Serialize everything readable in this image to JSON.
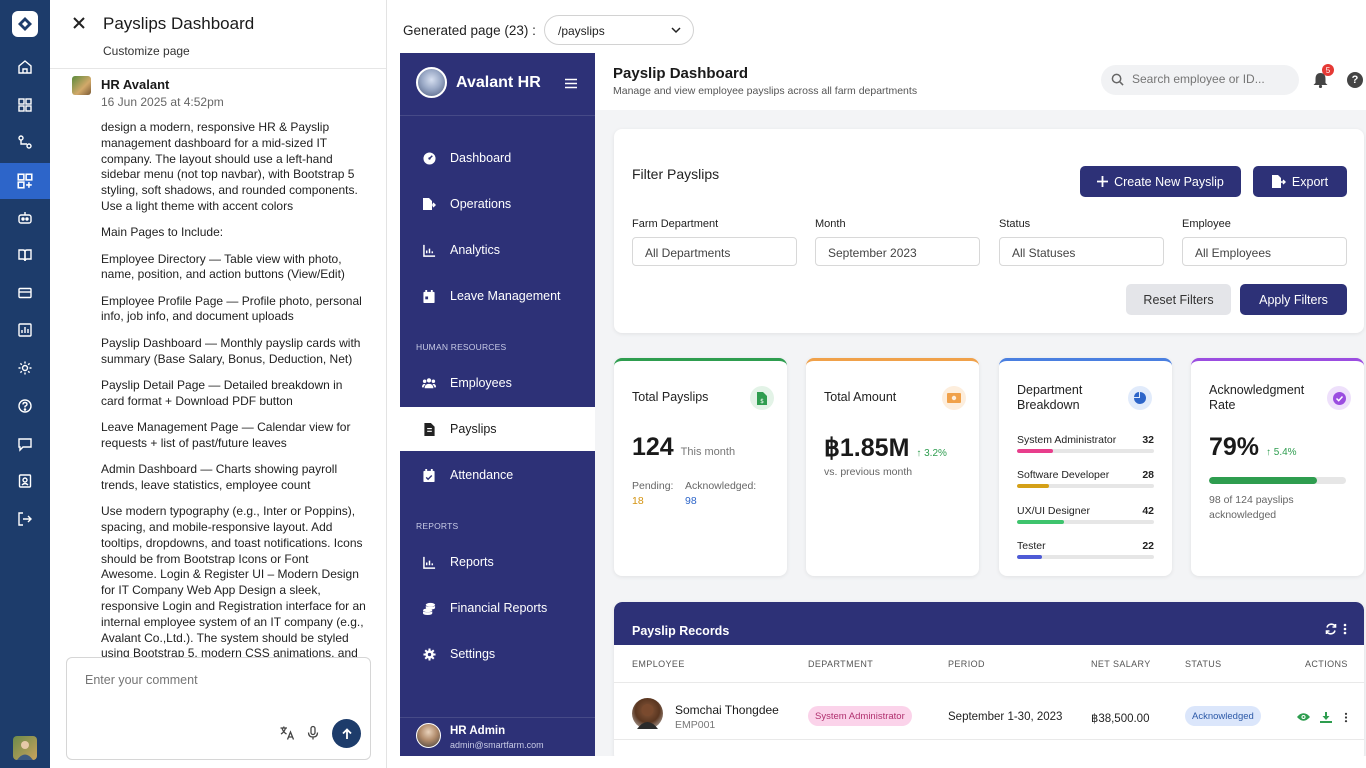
{
  "chat": {
    "title": "Payslips Dashboard",
    "subtitle": "Customize page",
    "author": "HR Avalant",
    "time": "16 Jun 2025 at 4:52pm",
    "paragraphs": [
      "design a modern, responsive HR & Payslip management dashboard for a mid-sized IT company. The layout should use a left-hand sidebar menu (not top navbar), with Bootstrap 5 styling, soft shadows, and rounded components. Use a light theme with accent colors",
      "Main Pages to Include:",
      "Employee Directory — Table view with photo, name, position, and action buttons (View/Edit)",
      "Employee Profile Page — Profile photo, personal info, job info, and document uploads",
      "Payslip Dashboard — Monthly payslip cards with summary (Base Salary, Bonus, Deduction, Net)",
      "Payslip Detail Page — Detailed breakdown in card format + Download PDF button",
      "Leave Management Page — Calendar view for requests + list of past/future leaves",
      "Admin Dashboard — Charts showing payroll trends, leave statistics, employee count",
      "Use modern typography (e.g., Inter or Poppins), spacing, and mobile-responsive layout. Add tooltips, dropdowns, and toast notifications. Icons should be from Bootstrap Icons or Font Awesome. Login & Register UI – Modern Design for IT Company Web App Design a sleek, responsive Login and Registration interface for an internal employee system of an IT company (e.g., Avalant Co.,Ltd.). The system should be styled using Bootstrap 5, modern CSS animations, and"
    ],
    "comment_placeholder": "Enter your comment"
  },
  "generator": {
    "label": "Generated page (23) :",
    "selected_page": "/payslips"
  },
  "sidebar": {
    "brand": "Avalant HR",
    "nav_main": [
      {
        "label": "Dashboard",
        "icon": "gauge-icon"
      },
      {
        "label": "Operations",
        "icon": "file-export-icon"
      },
      {
        "label": "Analytics",
        "icon": "chart-line-icon"
      },
      {
        "label": "Leave Management",
        "icon": "calendar-icon"
      }
    ],
    "section_hr": "HUMAN RESOURCES",
    "nav_hr": [
      {
        "label": "Employees",
        "icon": "users-icon"
      },
      {
        "label": "Payslips",
        "icon": "invoice-icon",
        "active": true
      },
      {
        "label": "Attendance",
        "icon": "calendar-check-icon"
      }
    ],
    "section_reports": "REPORTS",
    "nav_reports": [
      {
        "label": "Reports",
        "icon": "chart-line-icon"
      },
      {
        "label": "Financial Reports",
        "icon": "coins-icon"
      },
      {
        "label": "Settings",
        "icon": "gear-icon"
      }
    ],
    "user": {
      "name": "HR Admin",
      "email": "admin@smartfarm.com"
    }
  },
  "header": {
    "title": "Payslip Dashboard",
    "subtitle": "Manage and view employee payslips across all farm departments",
    "search_placeholder": "Search employee or ID...",
    "notification_count": "5",
    "help": "?"
  },
  "filters": {
    "title": "Filter Payslips",
    "create_label": "Create New Payslip",
    "export_label": "Export",
    "fields": [
      {
        "label": "Farm Department",
        "value": "All Departments"
      },
      {
        "label": "Month",
        "value": "September 2023"
      },
      {
        "label": "Status",
        "value": "All Statuses"
      },
      {
        "label": "Employee",
        "value": "All Employees"
      }
    ],
    "reset_label": "Reset Filters",
    "apply_label": "Apply Filters"
  },
  "stats": {
    "total_payslips": {
      "title": "Total Payslips",
      "value": "124",
      "suffix": "This month",
      "pending_label": "Pending:",
      "pending_value": "18",
      "ack_label": "Acknowledged:",
      "ack_value": "98"
    },
    "total_amount": {
      "title": "Total Amount",
      "value": "฿1.85M",
      "trend": "3.2%",
      "note": "vs. previous month"
    },
    "department": {
      "title": "Department Breakdown",
      "rows": [
        {
          "name": "System Administrator",
          "value": "32",
          "fraction": 0.26,
          "color": "#e83e8c"
        },
        {
          "name": "Software Developer",
          "value": "28",
          "fraction": 0.23,
          "color": "#d4a017"
        },
        {
          "name": "UX/UI Designer",
          "value": "42",
          "fraction": 0.34,
          "color": "#3ec46d"
        },
        {
          "name": "Tester",
          "value": "22",
          "fraction": 0.18,
          "color": "#4e5bd6"
        }
      ]
    },
    "ack_rate": {
      "title": "Acknowledgment Rate",
      "value": "79%",
      "trend": "5.4%",
      "fraction": 0.79,
      "note": "98 of 124 payslips acknowledged"
    }
  },
  "records": {
    "title": "Payslip Records",
    "columns": [
      "EMPLOYEE",
      "DEPARTMENT",
      "PERIOD",
      "NET SALARY",
      "STATUS",
      "ACTIONS"
    ],
    "rows": [
      {
        "name": "Somchai Thongdee",
        "id": "EMP001",
        "department": "System Administrator",
        "period": "September 1-30, 2023",
        "salary": "฿38,500.00",
        "status": "Acknowledged"
      }
    ]
  },
  "colors": {
    "sidebar": "#2d3177",
    "rail": "#1d3c6b",
    "accent_green": "#2e9d4f",
    "accent_orange": "#f0a14a",
    "accent_blue": "#4a7fe0",
    "accent_purple": "#9b4de0"
  }
}
